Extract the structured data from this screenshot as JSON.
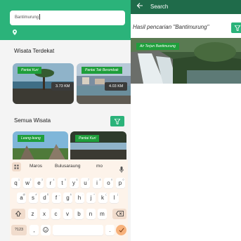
{
  "left_screen": {
    "search": {
      "value": "Bantimurung"
    },
    "nearby_title": "Wisata Terdekat",
    "nearby": [
      {
        "name": "Pantai Kuri",
        "distance": "3.73 KM"
      },
      {
        "name": "Pantai Tak Berombak",
        "distance": "4.03 KM"
      }
    ],
    "all_title": "Semua Wisata",
    "all": [
      {
        "name": "Leang-leang"
      },
      {
        "name": "Pantai Kuri"
      }
    ]
  },
  "keyboard": {
    "suggestions": [
      "Maros",
      "Bulusaraung",
      "mo"
    ],
    "row1": [
      "q",
      "w",
      "e",
      "r",
      "t",
      "y",
      "u",
      "i",
      "o",
      "p"
    ],
    "row1_alt": [
      "1",
      "2",
      "3",
      "4",
      "5",
      "6",
      "7",
      "8",
      "9",
      "0"
    ],
    "row2": [
      "a",
      "s",
      "d",
      "f",
      "g",
      "h",
      "j",
      "k",
      "l"
    ],
    "row2_alt": [
      "@",
      "#",
      "$",
      "_",
      "&",
      "-",
      "+",
      "(",
      ")"
    ],
    "row3": [
      "z",
      "x",
      "c",
      "v",
      "b",
      "n",
      "m"
    ],
    "symbols_label": "?123",
    "comma": ",",
    "period": "."
  },
  "right_screen": {
    "header_title": "Search",
    "result_prefix": "Hasil pencarian \"Bantimurung\"",
    "result_card": {
      "name": "Air Terjun Bantimurung"
    }
  },
  "icons": {
    "back": "arrow-left-icon",
    "filter": "filter-icon",
    "location": "location-pin-icon",
    "mic": "mic-icon",
    "emoji": "emoji-icon",
    "backspace": "backspace-icon",
    "shift": "shift-icon",
    "enter": "check-icon",
    "grid": "grid-icon"
  },
  "colors": {
    "primary": "#2bb37a",
    "header_dark": "#1f6b4a",
    "tag": "#1f9e3b"
  }
}
